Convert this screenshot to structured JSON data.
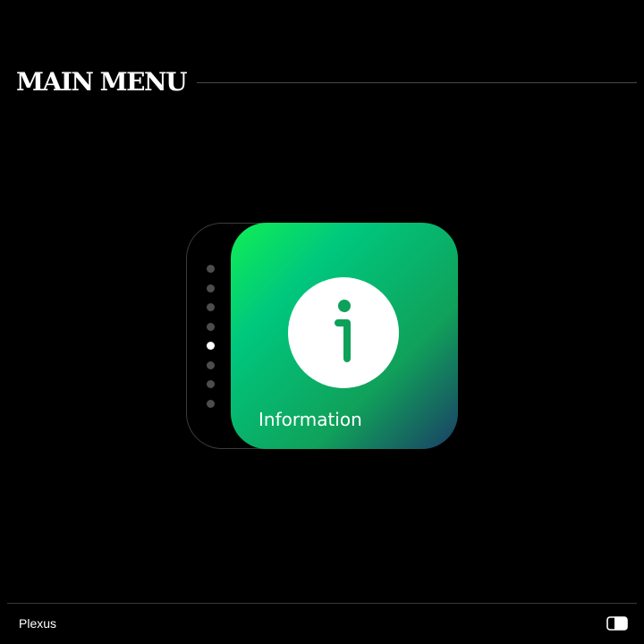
{
  "header": {
    "title": "MAIN MENU"
  },
  "menu": {
    "pager": {
      "total": 8,
      "active_index": 4
    },
    "current_item": {
      "label": "Information",
      "icon": "info-icon"
    }
  },
  "footer": {
    "brand": "Plexus",
    "toggle_icon": "theme-toggle-icon"
  },
  "colors": {
    "background": "#000000",
    "card_gradient_start": "#10ee55",
    "card_gradient_mid": "#00c77e",
    "card_gradient_end": "#1b3e66",
    "icon_accent": "#0da15a",
    "dot_inactive": "#4d4d4d",
    "dot_active": "#ffffff"
  }
}
